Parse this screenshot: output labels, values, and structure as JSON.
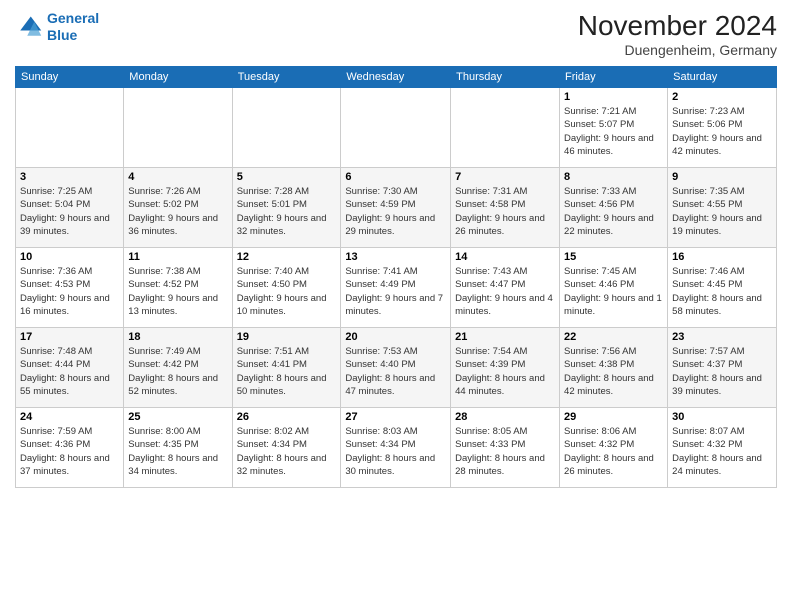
{
  "header": {
    "logo_line1": "General",
    "logo_line2": "Blue",
    "month_title": "November 2024",
    "location": "Duengenheim, Germany"
  },
  "weekdays": [
    "Sunday",
    "Monday",
    "Tuesday",
    "Wednesday",
    "Thursday",
    "Friday",
    "Saturday"
  ],
  "weeks": [
    [
      {
        "day": "",
        "info": ""
      },
      {
        "day": "",
        "info": ""
      },
      {
        "day": "",
        "info": ""
      },
      {
        "day": "",
        "info": ""
      },
      {
        "day": "",
        "info": ""
      },
      {
        "day": "1",
        "info": "Sunrise: 7:21 AM\nSunset: 5:07 PM\nDaylight: 9 hours and 46 minutes."
      },
      {
        "day": "2",
        "info": "Sunrise: 7:23 AM\nSunset: 5:06 PM\nDaylight: 9 hours and 42 minutes."
      }
    ],
    [
      {
        "day": "3",
        "info": "Sunrise: 7:25 AM\nSunset: 5:04 PM\nDaylight: 9 hours and 39 minutes."
      },
      {
        "day": "4",
        "info": "Sunrise: 7:26 AM\nSunset: 5:02 PM\nDaylight: 9 hours and 36 minutes."
      },
      {
        "day": "5",
        "info": "Sunrise: 7:28 AM\nSunset: 5:01 PM\nDaylight: 9 hours and 32 minutes."
      },
      {
        "day": "6",
        "info": "Sunrise: 7:30 AM\nSunset: 4:59 PM\nDaylight: 9 hours and 29 minutes."
      },
      {
        "day": "7",
        "info": "Sunrise: 7:31 AM\nSunset: 4:58 PM\nDaylight: 9 hours and 26 minutes."
      },
      {
        "day": "8",
        "info": "Sunrise: 7:33 AM\nSunset: 4:56 PM\nDaylight: 9 hours and 22 minutes."
      },
      {
        "day": "9",
        "info": "Sunrise: 7:35 AM\nSunset: 4:55 PM\nDaylight: 9 hours and 19 minutes."
      }
    ],
    [
      {
        "day": "10",
        "info": "Sunrise: 7:36 AM\nSunset: 4:53 PM\nDaylight: 9 hours and 16 minutes."
      },
      {
        "day": "11",
        "info": "Sunrise: 7:38 AM\nSunset: 4:52 PM\nDaylight: 9 hours and 13 minutes."
      },
      {
        "day": "12",
        "info": "Sunrise: 7:40 AM\nSunset: 4:50 PM\nDaylight: 9 hours and 10 minutes."
      },
      {
        "day": "13",
        "info": "Sunrise: 7:41 AM\nSunset: 4:49 PM\nDaylight: 9 hours and 7 minutes."
      },
      {
        "day": "14",
        "info": "Sunrise: 7:43 AM\nSunset: 4:47 PM\nDaylight: 9 hours and 4 minutes."
      },
      {
        "day": "15",
        "info": "Sunrise: 7:45 AM\nSunset: 4:46 PM\nDaylight: 9 hours and 1 minute."
      },
      {
        "day": "16",
        "info": "Sunrise: 7:46 AM\nSunset: 4:45 PM\nDaylight: 8 hours and 58 minutes."
      }
    ],
    [
      {
        "day": "17",
        "info": "Sunrise: 7:48 AM\nSunset: 4:44 PM\nDaylight: 8 hours and 55 minutes."
      },
      {
        "day": "18",
        "info": "Sunrise: 7:49 AM\nSunset: 4:42 PM\nDaylight: 8 hours and 52 minutes."
      },
      {
        "day": "19",
        "info": "Sunrise: 7:51 AM\nSunset: 4:41 PM\nDaylight: 8 hours and 50 minutes."
      },
      {
        "day": "20",
        "info": "Sunrise: 7:53 AM\nSunset: 4:40 PM\nDaylight: 8 hours and 47 minutes."
      },
      {
        "day": "21",
        "info": "Sunrise: 7:54 AM\nSunset: 4:39 PM\nDaylight: 8 hours and 44 minutes."
      },
      {
        "day": "22",
        "info": "Sunrise: 7:56 AM\nSunset: 4:38 PM\nDaylight: 8 hours and 42 minutes."
      },
      {
        "day": "23",
        "info": "Sunrise: 7:57 AM\nSunset: 4:37 PM\nDaylight: 8 hours and 39 minutes."
      }
    ],
    [
      {
        "day": "24",
        "info": "Sunrise: 7:59 AM\nSunset: 4:36 PM\nDaylight: 8 hours and 37 minutes."
      },
      {
        "day": "25",
        "info": "Sunrise: 8:00 AM\nSunset: 4:35 PM\nDaylight: 8 hours and 34 minutes."
      },
      {
        "day": "26",
        "info": "Sunrise: 8:02 AM\nSunset: 4:34 PM\nDaylight: 8 hours and 32 minutes."
      },
      {
        "day": "27",
        "info": "Sunrise: 8:03 AM\nSunset: 4:34 PM\nDaylight: 8 hours and 30 minutes."
      },
      {
        "day": "28",
        "info": "Sunrise: 8:05 AM\nSunset: 4:33 PM\nDaylight: 8 hours and 28 minutes."
      },
      {
        "day": "29",
        "info": "Sunrise: 8:06 AM\nSunset: 4:32 PM\nDaylight: 8 hours and 26 minutes."
      },
      {
        "day": "30",
        "info": "Sunrise: 8:07 AM\nSunset: 4:32 PM\nDaylight: 8 hours and 24 minutes."
      }
    ]
  ]
}
